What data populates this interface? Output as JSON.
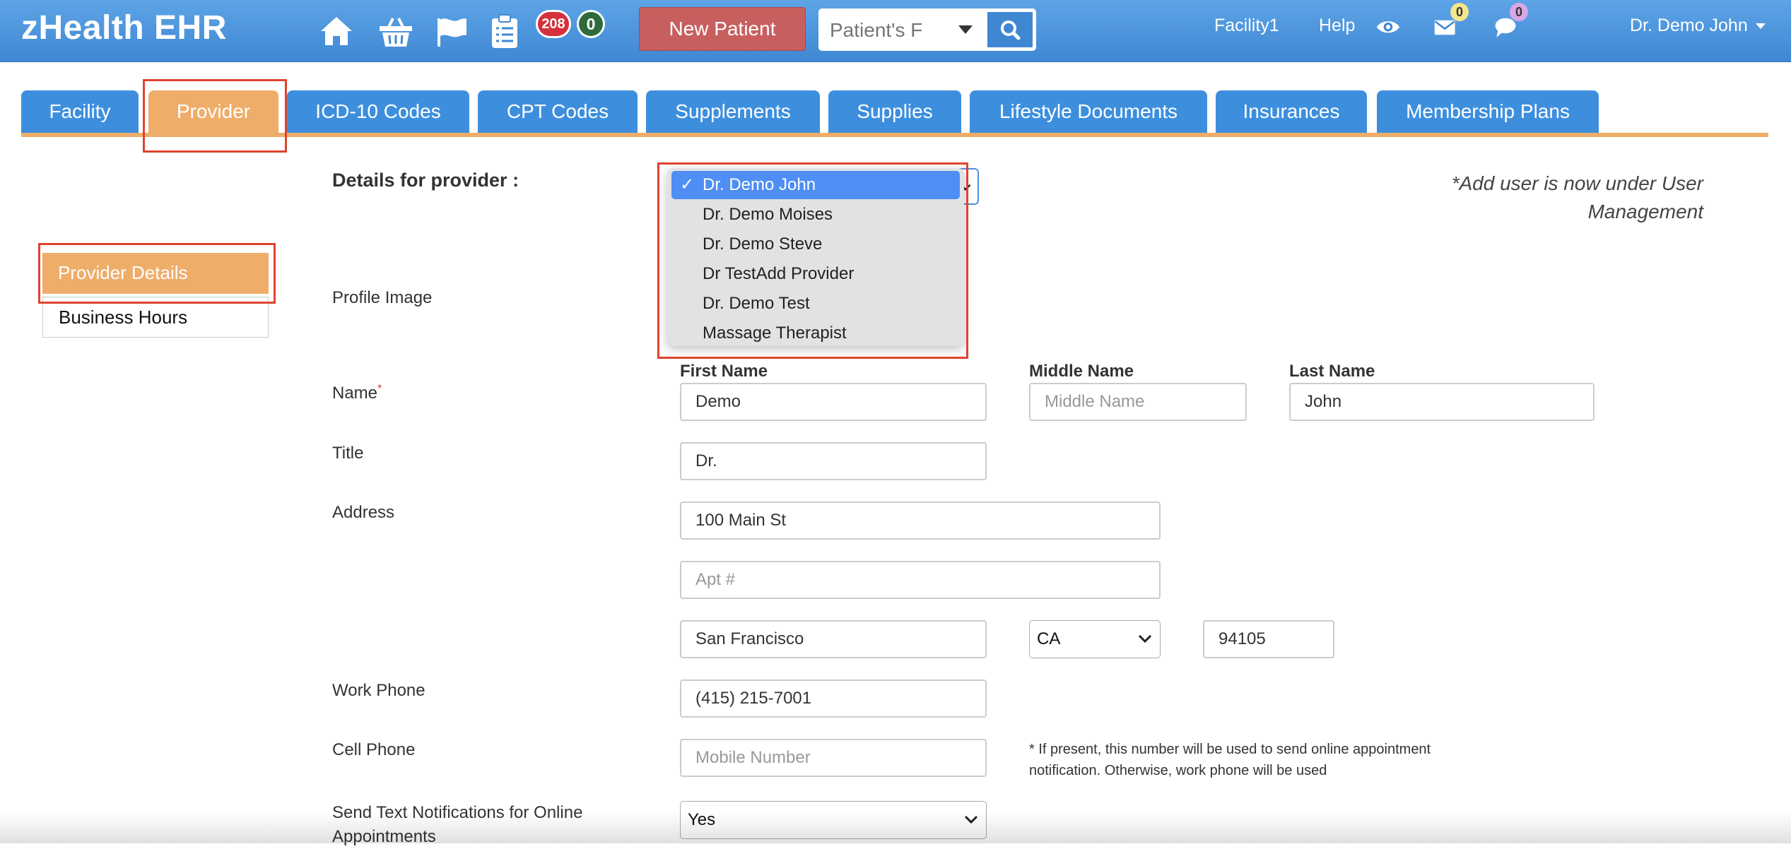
{
  "app": {
    "brand": "zHealth EHR",
    "badges": {
      "red": "208",
      "green": "0"
    },
    "new_patient_label": "New Patient",
    "search_placeholder": "Patient's F",
    "facility": "Facility1",
    "help": "Help",
    "mail_count": "0",
    "chat_count": "0",
    "user": "Dr. Demo John"
  },
  "tabs": [
    {
      "label": "Facility"
    },
    {
      "label": "Provider",
      "active": true
    },
    {
      "label": "ICD-10 Codes"
    },
    {
      "label": "CPT Codes"
    },
    {
      "label": "Supplements"
    },
    {
      "label": "Supplies"
    },
    {
      "label": "Lifestyle Documents"
    },
    {
      "label": "Insurances"
    },
    {
      "label": "Membership Plans"
    }
  ],
  "sidemenu": [
    {
      "label": "Provider Details",
      "active": true
    },
    {
      "label": "Business Hours"
    }
  ],
  "form": {
    "details_label": "Details for provider :",
    "add_user_note_1": "*Add user is now under User",
    "add_user_note_2": "Management",
    "profile_image_label": "Profile Image",
    "name_label": "Name",
    "required_mark": "*",
    "first_name_head": "First Name",
    "middle_name_head": "Middle Name",
    "last_name_head": "Last Name",
    "first_name": "Demo",
    "middle_name_placeholder": "Middle Name",
    "last_name": "John",
    "title_label": "Title",
    "title": "Dr.",
    "address_label": "Address",
    "address1": "100 Main St",
    "address2_placeholder": "Apt #",
    "city": "San Francisco",
    "state": "CA",
    "zip": "94105",
    "work_phone_label": "Work Phone",
    "work_phone": "(415) 215-7001",
    "cell_phone_label": "Cell Phone",
    "cell_phone_placeholder": "Mobile Number",
    "cell_note_1": "* If present, this number will be used to send online appointment",
    "cell_note_2": "notification. Otherwise, work phone will be used",
    "send_text_label_1": "Send Text Notifications for Online",
    "send_text_label_2": "Appointments",
    "send_text_value": "Yes"
  },
  "provider_dropdown": {
    "options": [
      {
        "label": "Dr. Demo John",
        "selected": true
      },
      {
        "label": "Dr. Demo Moises"
      },
      {
        "label": "Dr. Demo Steve"
      },
      {
        "label": "Dr TestAdd Provider"
      },
      {
        "label": "Dr. Demo Test"
      },
      {
        "label": "Massage Therapist"
      }
    ],
    "check": "✓"
  },
  "colors": {
    "navbar": "#4a95dd",
    "tab": "#3d8fde",
    "active_tab": "#efad6a",
    "new_patient": "#c85f5f",
    "highlight": "#e0432f",
    "dropdown_selected": "#4f8ef5"
  },
  "icons": [
    "home-icon",
    "basket-icon",
    "flag-icon",
    "clipboard-icon",
    "search-icon",
    "eye-icon",
    "envelope-icon",
    "chat-icon",
    "caret-down-icon",
    "chevron-down-icon",
    "checkmark-icon"
  ]
}
